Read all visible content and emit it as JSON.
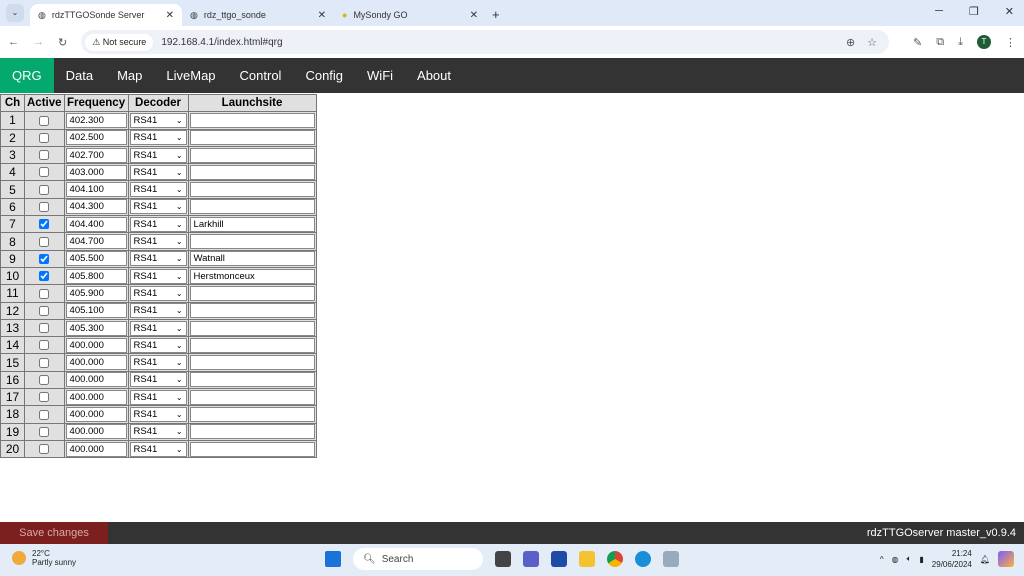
{
  "browser": {
    "tabs": [
      {
        "title": "rdzTTGOSonde Server",
        "active": true
      },
      {
        "title": "rdz_ttgo_sonde",
        "active": false
      },
      {
        "title": "MySondy GO",
        "active": false
      }
    ],
    "security": "Not secure",
    "url": "192.168.4.1/index.html#qrg",
    "profile_initial": "T"
  },
  "nav": {
    "items": [
      "QRG",
      "Data",
      "Map",
      "LiveMap",
      "Control",
      "Config",
      "WiFi",
      "About"
    ],
    "active": "QRG",
    "active_color": "#04aa6d"
  },
  "table": {
    "headers": [
      "Ch",
      "Active",
      "Frequency",
      "Decoder",
      "Launchsite"
    ],
    "rows": [
      {
        "ch": "1",
        "active": false,
        "freq": "402.300",
        "decoder": "RS41",
        "site": ""
      },
      {
        "ch": "2",
        "active": false,
        "freq": "402.500",
        "decoder": "RS41",
        "site": ""
      },
      {
        "ch": "3",
        "active": false,
        "freq": "402.700",
        "decoder": "RS41",
        "site": ""
      },
      {
        "ch": "4",
        "active": false,
        "freq": "403.000",
        "decoder": "RS41",
        "site": ""
      },
      {
        "ch": "5",
        "active": false,
        "freq": "404.100",
        "decoder": "RS41",
        "site": ""
      },
      {
        "ch": "6",
        "active": false,
        "freq": "404.300",
        "decoder": "RS41",
        "site": ""
      },
      {
        "ch": "7",
        "active": true,
        "freq": "404.400",
        "decoder": "RS41",
        "site": "Larkhill"
      },
      {
        "ch": "8",
        "active": false,
        "freq": "404.700",
        "decoder": "RS41",
        "site": ""
      },
      {
        "ch": "9",
        "active": true,
        "freq": "405.500",
        "decoder": "RS41",
        "site": "Watnall"
      },
      {
        "ch": "10",
        "active": true,
        "freq": "405.800",
        "decoder": "RS41",
        "site": "Herstmonceux"
      },
      {
        "ch": "11",
        "active": false,
        "freq": "405.900",
        "decoder": "RS41",
        "site": ""
      },
      {
        "ch": "12",
        "active": false,
        "freq": "405.100",
        "decoder": "RS41",
        "site": ""
      },
      {
        "ch": "13",
        "active": false,
        "freq": "405.300",
        "decoder": "RS41",
        "site": ""
      },
      {
        "ch": "14",
        "active": false,
        "freq": "400.000",
        "decoder": "RS41",
        "site": ""
      },
      {
        "ch": "15",
        "active": false,
        "freq": "400.000",
        "decoder": "RS41",
        "site": ""
      },
      {
        "ch": "16",
        "active": false,
        "freq": "400.000",
        "decoder": "RS41",
        "site": ""
      },
      {
        "ch": "17",
        "active": false,
        "freq": "400.000",
        "decoder": "RS41",
        "site": ""
      },
      {
        "ch": "18",
        "active": false,
        "freq": "400.000",
        "decoder": "RS41",
        "site": ""
      },
      {
        "ch": "19",
        "active": false,
        "freq": "400.000",
        "decoder": "RS41",
        "site": ""
      },
      {
        "ch": "20",
        "active": false,
        "freq": "400.000",
        "decoder": "RS41",
        "site": ""
      }
    ]
  },
  "footer": {
    "save_label": "Save changes",
    "version": "rdzTTGOserver master_v0.9.4"
  },
  "taskbar": {
    "temperature": "22°C",
    "weather": "Partly sunny",
    "search": "Search",
    "time": "21:24",
    "date": "29/06/2024"
  }
}
